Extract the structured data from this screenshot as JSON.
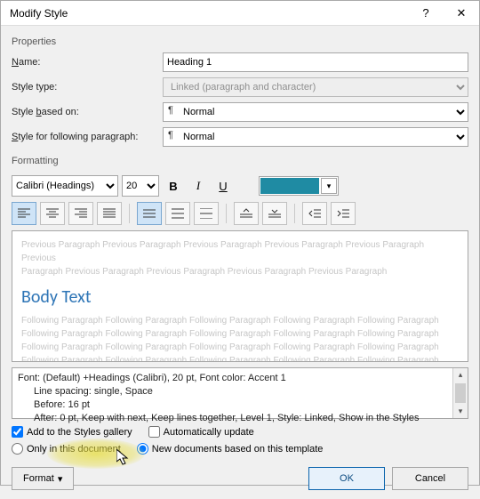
{
  "title": "Modify Style",
  "sections": {
    "properties": "Properties",
    "formatting": "Formatting"
  },
  "properties": {
    "name_label": "Name:",
    "name_value": "Heading 1",
    "type_label": "Style type:",
    "type_value": "Linked (paragraph and character)",
    "based_label": "Style based on:",
    "based_value": "Normal",
    "following_label": "Style for following paragraph:",
    "following_value": "Normal"
  },
  "formatting": {
    "font_name": "Calibri (Headings)",
    "font_size": "20",
    "bold": "B",
    "italic": "I",
    "underline": "U",
    "accent_color": "#1f8ba3"
  },
  "preview": {
    "prev_line1": "Previous Paragraph Previous Paragraph Previous Paragraph Previous Paragraph Previous Paragraph Previous",
    "prev_line2": "Paragraph Previous Paragraph Previous Paragraph Previous Paragraph Previous Paragraph",
    "body_text": "Body Text",
    "foll_line": "Following Paragraph Following Paragraph Following Paragraph Following Paragraph Following Paragraph"
  },
  "description": {
    "line1": "Font: (Default) +Headings (Calibri), 20 pt, Font color: Accent 1",
    "line2": "Line spacing:  single, Space",
    "line3": "Before:  16 pt",
    "line4": "After:  0 pt, Keep with next, Keep lines together, Level 1, Style: Linked, Show in the Styles"
  },
  "options": {
    "add_gallery": "Add to the Styles gallery",
    "auto_update": "Automatically update",
    "only_doc": "Only in this document",
    "new_docs": "New documents based on this template"
  },
  "buttons": {
    "format": "Format",
    "ok": "OK",
    "cancel": "Cancel"
  }
}
